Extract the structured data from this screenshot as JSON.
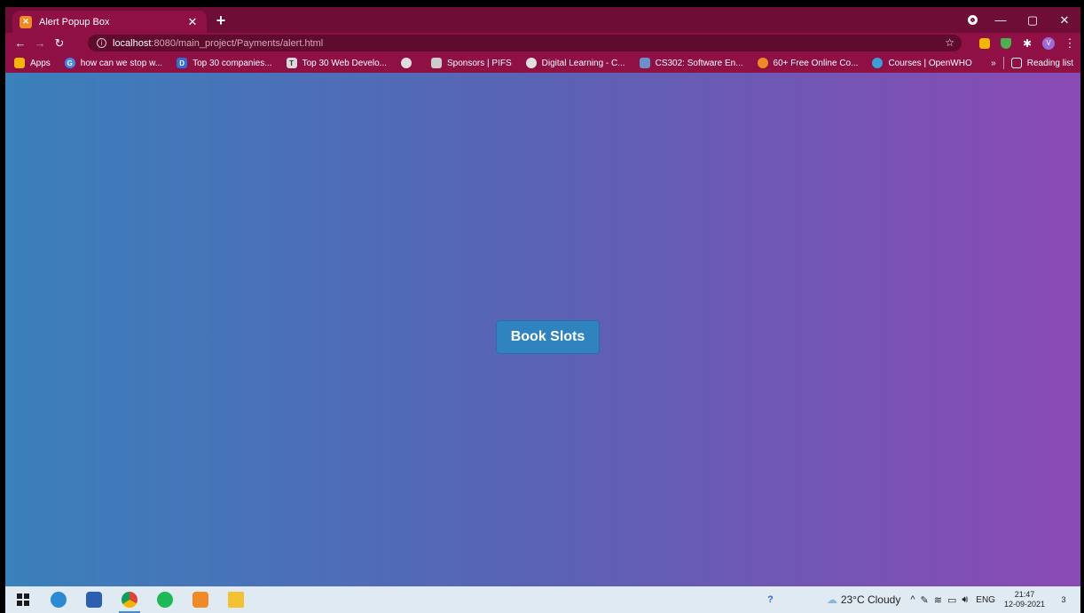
{
  "browser": {
    "tab": {
      "title": "Alert Popup Box",
      "favicon": "xampp-icon"
    },
    "url": {
      "host": "localhost",
      "rest": ":8080/main_project/Payments/alert.html"
    },
    "profile_initial": "V",
    "bookmarks": [
      {
        "label": "Apps",
        "color": "#f2b705"
      },
      {
        "label": "how can we stop w...",
        "color": "#4285f4"
      },
      {
        "label": "Top 30 companies...",
        "color": "#2d6fd6"
      },
      {
        "label": "Top 30 Web Develo...",
        "color": "#d9d9d9"
      },
      {
        "label": "",
        "color": "#e0e0e0"
      },
      {
        "label": "Sponsors | PIFS",
        "color": "#cccccc"
      },
      {
        "label": "Digital Learning - C...",
        "color": "#e0e0e0"
      },
      {
        "label": "CS302: Software En...",
        "color": "#6b8fc9"
      },
      {
        "label": "60+ Free Online Co...",
        "color": "#f08a24"
      },
      {
        "label": "Courses | OpenWHO",
        "color": "#3aa0d8"
      }
    ],
    "reading_list": "Reading list"
  },
  "page": {
    "button_label": "Book Slots"
  },
  "taskbar": {
    "weather": "23°C  Cloudy",
    "lang": "ENG",
    "time": "21:47",
    "date": "12-09-2021",
    "notification_count": "3"
  },
  "colors": {
    "gradient_start": "#3a80bb",
    "gradient_end": "#8a4ab3",
    "chrome_frame": "#8f1044"
  }
}
